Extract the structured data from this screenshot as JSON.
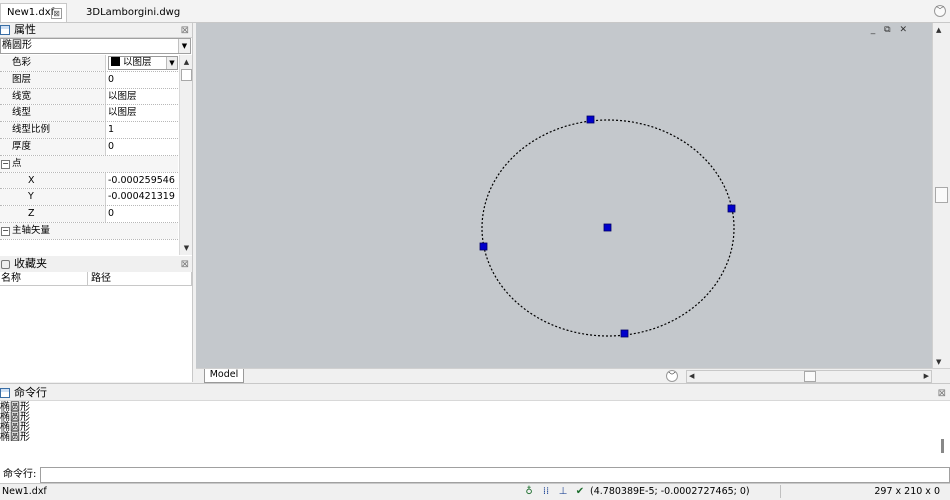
{
  "tabs": {
    "active": {
      "label": "New1.dxf",
      "close": "⊠"
    },
    "second": {
      "label": "3DLamborgini.dwg"
    },
    "menu": "﹀"
  },
  "properties": {
    "title": "属性",
    "close": "⊠",
    "entity_type": "椭圆形",
    "rows": [
      {
        "name": "色彩",
        "value": "以图层",
        "kind": "color",
        "swatch": "#000000"
      },
      {
        "name": "图层",
        "value": "0"
      },
      {
        "name": "线宽",
        "value": "以图层"
      },
      {
        "name": "线型",
        "value": "以图层"
      },
      {
        "name": "线型比例",
        "value": "1"
      },
      {
        "name": "厚度",
        "value": "0"
      },
      {
        "name": "点",
        "kind": "category"
      },
      {
        "name": "X",
        "value": "-0.000259546",
        "kind": "sub"
      },
      {
        "name": "Y",
        "value": "-0.000421319",
        "kind": "sub"
      },
      {
        "name": "Z",
        "value": "0",
        "kind": "sub"
      },
      {
        "name": "主轴矢量",
        "kind": "category"
      }
    ],
    "collapse_glyph": "−"
  },
  "favorites": {
    "title": "收藏夹",
    "close": "⊠",
    "columns": [
      "名称",
      "路径"
    ]
  },
  "viewport": {
    "background": "#c4c8cc",
    "window_controls": "_ ⧉ ✕",
    "model_tab": "Model",
    "nav_glyph": "﹀",
    "ellipse": {
      "stroke": "#000000",
      "grip_color": "#0000cc",
      "grip_border": "#000066"
    }
  },
  "command": {
    "title": "命令行",
    "close": "⊠",
    "history": [
      "椭圆形",
      "椭圆形",
      "椭圆形",
      "椭圆形"
    ],
    "prompt_label": "命令行:",
    "input_value": ""
  },
  "status": {
    "file": "New1.dxf",
    "coords": "(4.780389E-5; -0.0002727465; 0)",
    "paper": "297 x 210 x 0"
  }
}
